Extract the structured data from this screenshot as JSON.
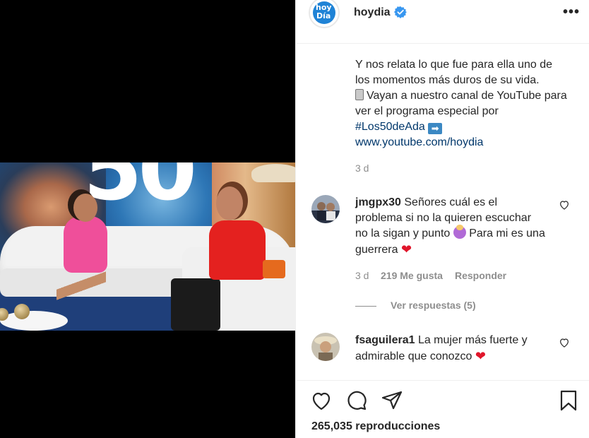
{
  "post": {
    "account": {
      "username": "hoydia",
      "logo_line1": "hoy",
      "logo_line2": "Día",
      "verified": true,
      "more_label": "•••"
    },
    "caption": {
      "line1": "Y nos relata lo que fue para ella uno de los momentos más duros de su vida.",
      "line2": "Vayan a nuestro canal de YouTube para ver el programa especial por",
      "hashtag": "#Los50deAda",
      "arrow": "➡",
      "link": "www.youtube.com/hoydia",
      "time": "3 d"
    },
    "comments": [
      {
        "username": "jmgpx30",
        "text_part1": "Señores cuál es el problema si no la quieren escuchar no la sigan y punto",
        "text_part2": "Para mi es una guerrera",
        "time": "3 d",
        "likes": "219 Me gusta",
        "reply_label": "Responder",
        "view_replies": "Ver respuestas (5)"
      },
      {
        "username": "fsaguilera1",
        "text": "La mujer más fuerte y admirable que conozco"
      }
    ],
    "video": {
      "overlay_number": "50"
    },
    "views": "265,035 reproducciones",
    "colors": {
      "link": "#00376b",
      "muted": "#8e8e8e",
      "verified": "#3897f0",
      "heart": "#e0162b"
    },
    "icons": [
      "heart-icon",
      "comment-icon",
      "share-icon",
      "bookmark-icon",
      "more-icon",
      "verified-icon"
    ]
  }
}
